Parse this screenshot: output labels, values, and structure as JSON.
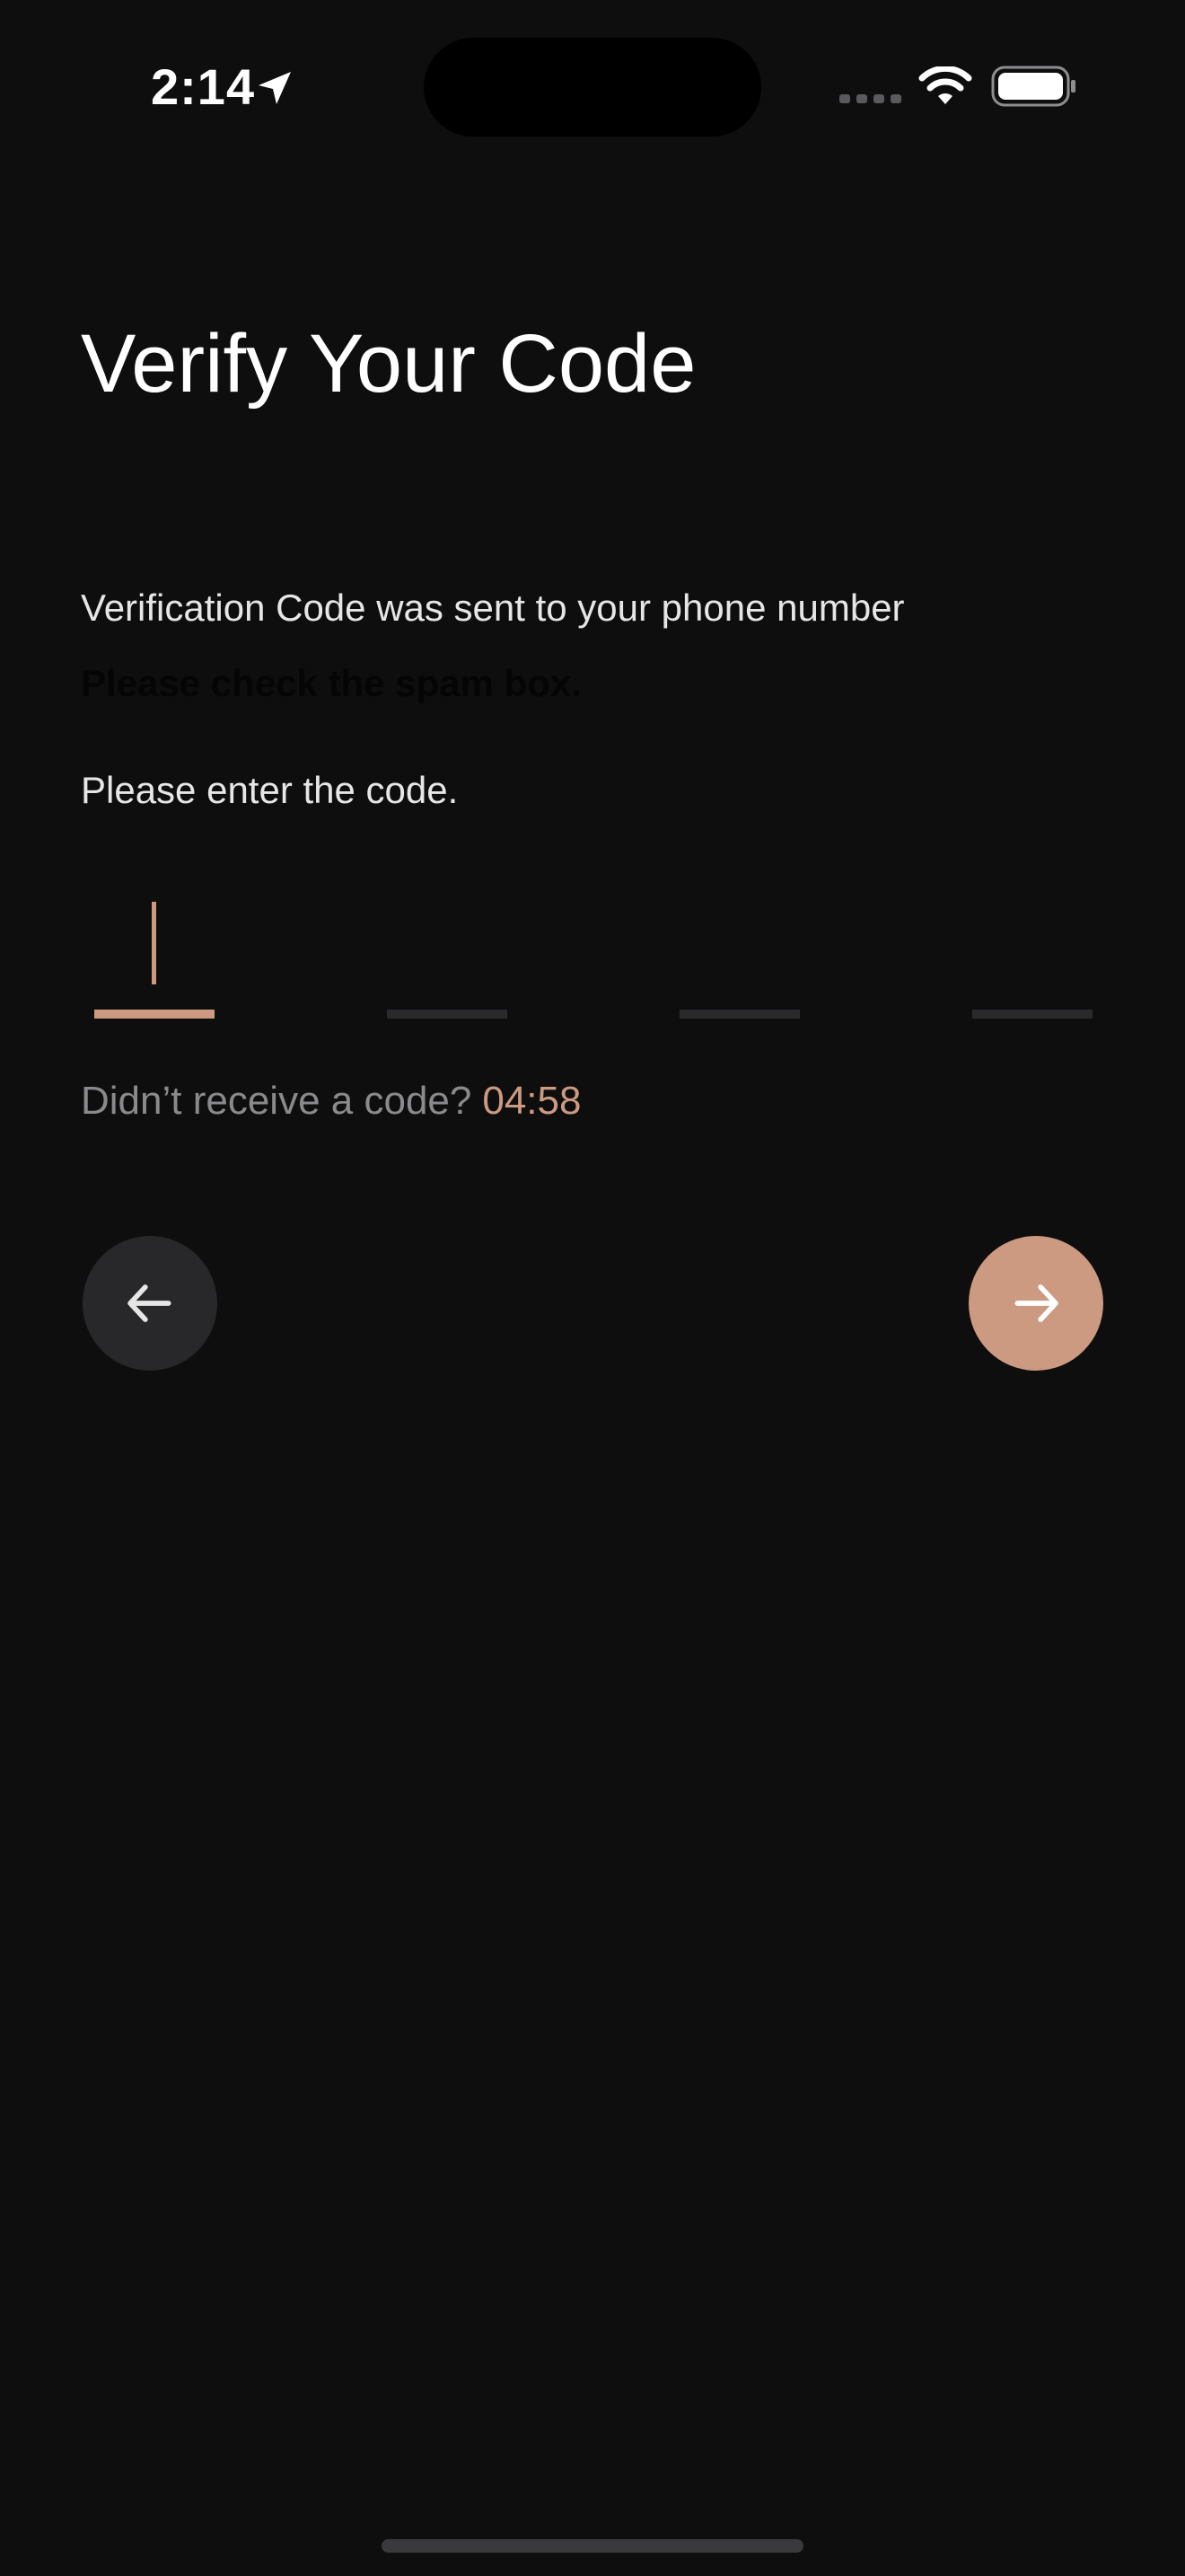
{
  "status_bar": {
    "time": "2:14",
    "icons": [
      "location-arrow-icon",
      "cellular-signal-icon",
      "wifi-icon",
      "battery-icon"
    ]
  },
  "screen": {
    "title": "Verify Your Code",
    "sent_message": "Verification Code was sent to your phone number",
    "spam_hint": "Please check the spam box.",
    "enter_prompt": "Please enter the code."
  },
  "code_input": {
    "digits": [
      "",
      "",
      "",
      ""
    ],
    "active_index": 0
  },
  "resend": {
    "label": "Didn’t receive a code?",
    "timer": "04:58"
  },
  "navigation": {
    "back_icon": "arrow-left-icon",
    "next_icon": "arrow-right-icon"
  },
  "colors": {
    "background": "#0e0e0f",
    "accent": "#cc9a81",
    "muted_text": "#8a8a8c",
    "inactive_underline": "#2a2a2c",
    "back_button": "#28282a"
  }
}
